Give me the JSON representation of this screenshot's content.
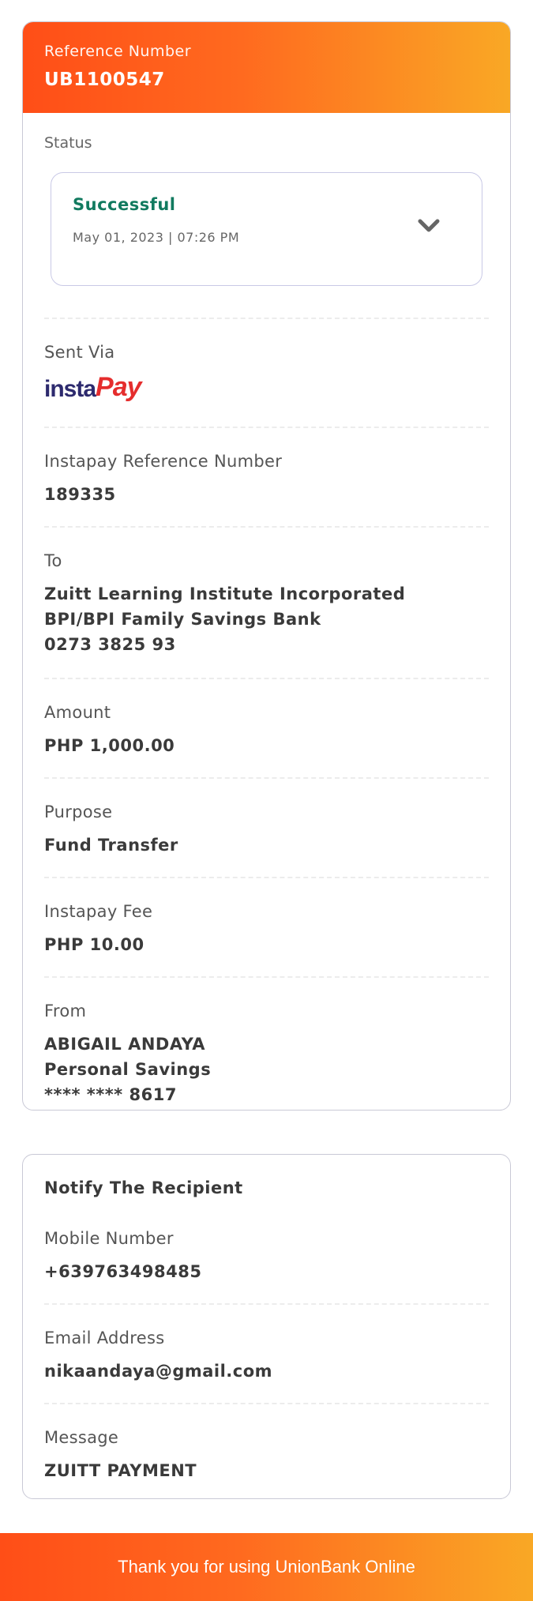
{
  "reference": {
    "label": "Reference Number",
    "value": "UB1100547"
  },
  "status": {
    "label": "Status",
    "text": "Successful",
    "datetime": "May 01, 2023 | 07:26 PM"
  },
  "sent_via": {
    "label": "Sent Via",
    "logo_insta": "insta",
    "logo_pay": "Pay"
  },
  "instapay_ref": {
    "label": "Instapay Reference Number",
    "value": "189335"
  },
  "to": {
    "label": "To",
    "name": "Zuitt Learning Institute Incorporated",
    "bank": "BPI/BPI Family Savings Bank",
    "account": "0273 3825 93"
  },
  "amount": {
    "label": "Amount",
    "value": "PHP 1,000.00"
  },
  "purpose": {
    "label": "Purpose",
    "value": "Fund Transfer"
  },
  "fee": {
    "label": "Instapay Fee",
    "value": "PHP 10.00"
  },
  "from": {
    "label": "From",
    "name": "ABIGAIL ANDAYA",
    "account_type": "Personal Savings",
    "account": "**** **** 8617"
  },
  "notify": {
    "title": "Notify The Recipient",
    "mobile_label": "Mobile Number",
    "mobile_value": "+639763498485",
    "email_label": "Email Address",
    "email_value": "nikaandaya@gmail.com",
    "message_label": "Message",
    "message_value": "ZUITT PAYMENT"
  },
  "footer": {
    "text": "Thank you for using UnionBank Online"
  },
  "colors": {
    "accent_start": "#ff4e17",
    "accent_end": "#f9a825",
    "success": "#117a5f"
  },
  "icons": {
    "status_toggle": "chevron-down-icon"
  }
}
